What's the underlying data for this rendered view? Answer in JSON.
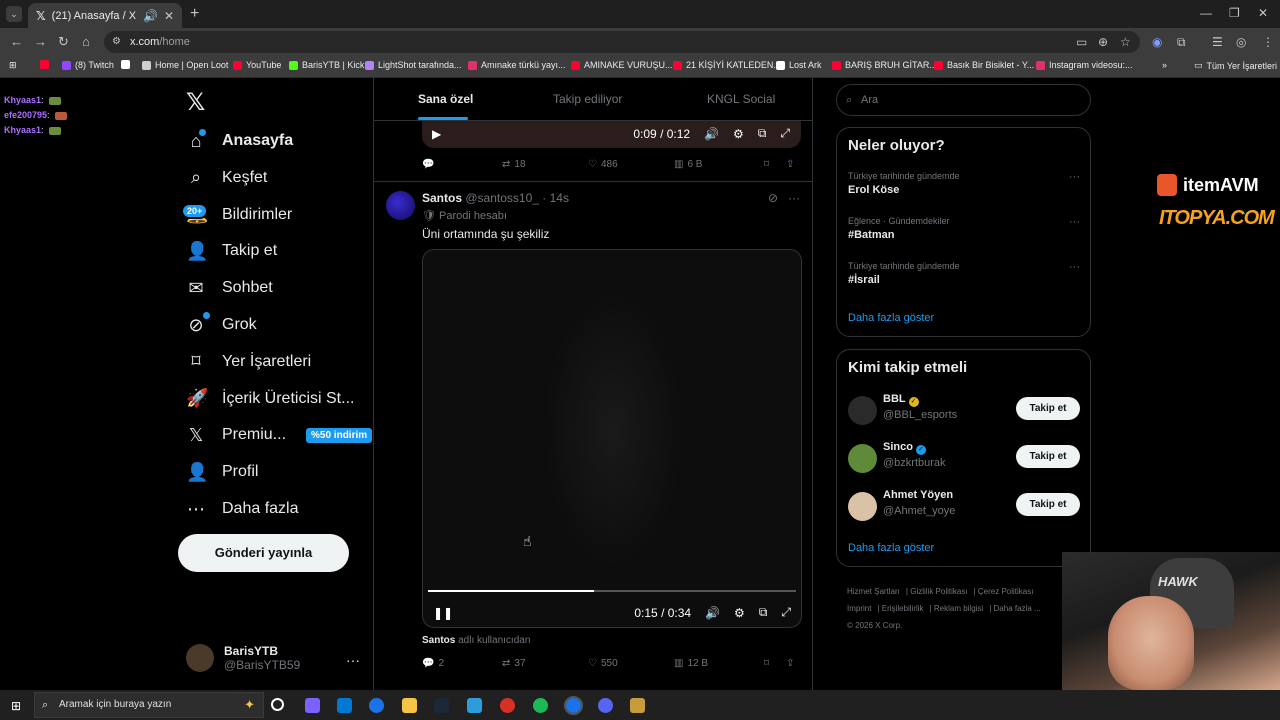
{
  "browser": {
    "tab_title": "(21) Anasayfa / X",
    "url_host": "x.com",
    "url_path": "/home",
    "all_bookmarks": "Tüm Yer İşaretleri",
    "bookmarks": [
      {
        "label": "",
        "color": "#ff0033"
      },
      {
        "label": "(8) Twitch",
        "color": "#9146ff"
      },
      {
        "label": "",
        "color": "#ffffff"
      },
      {
        "label": "Home | Open Loot",
        "color": "#d0d0d0"
      },
      {
        "label": "YouTube",
        "color": "#ff0033"
      },
      {
        "label": "BarisYTB | Kick",
        "color": "#53fc18"
      },
      {
        "label": "LightShot tarafında...",
        "color": "#b084f5"
      },
      {
        "label": "Amınake türkü yayı...",
        "color": "#e1306c"
      },
      {
        "label": "AMINAKE VURUŞU...",
        "color": "#ff0033"
      },
      {
        "label": "21 KİŞİYİ KATLEDEN...",
        "color": "#ff0033"
      },
      {
        "label": "Lost Ark",
        "color": "#ffffff"
      },
      {
        "label": "BARIŞ BRUH GİTAR...",
        "color": "#ff0033"
      },
      {
        "label": "Basık Bir Bisiklet - Y...",
        "color": "#ff0033"
      },
      {
        "label": "Instagram videosu:...",
        "color": "#e1306c"
      }
    ]
  },
  "chat": [
    {
      "user": "Khyaas1",
      "sep": ":"
    },
    {
      "user": "efe200795",
      "sep": ":"
    },
    {
      "user": "Khyaas1",
      "sep": ":"
    }
  ],
  "nav": {
    "items": [
      {
        "label": "Anasayfa",
        "icon": "home-icon"
      },
      {
        "label": "Keşfet",
        "icon": "search-icon"
      },
      {
        "label": "Bildirimler",
        "icon": "bell-icon"
      },
      {
        "label": "Takip et",
        "icon": "add-person-icon"
      },
      {
        "label": "Sohbet",
        "icon": "mail-icon"
      },
      {
        "label": "Grok",
        "icon": "grok-icon"
      },
      {
        "label": "Yer İşaretleri",
        "icon": "bookmark-icon"
      },
      {
        "label": "İçerik Üreticisi St...",
        "icon": "rocket-icon"
      },
      {
        "label": "Premiu...",
        "icon": "x-icon"
      },
      {
        "label": "Profil",
        "icon": "person-icon"
      },
      {
        "label": "Daha fazla",
        "icon": "more-circle-icon"
      }
    ],
    "notifications_badge": "20+",
    "premium_promo": "%50 indirim",
    "post_button": "Gönderi yayınla",
    "account_name": "BarisYTB",
    "account_handle": "@BarisYTB59"
  },
  "timeline": {
    "tabs": [
      "Sana özel",
      "Takip ediliyor",
      "KNGL Social"
    ],
    "tweet1": {
      "video_time": "0:09 / 0:12",
      "replies": "",
      "retweets": "18",
      "likes": "486",
      "views": "6 B"
    },
    "tweet2": {
      "name": "Santos",
      "handle": "@santoss10_",
      "time": "· 14s",
      "parody": "Parodi hesabı",
      "text": "Üni ortamında şu şekiliz",
      "video_time": "0:15 / 0:34",
      "progress": 0.45,
      "caption_name": "Santos",
      "caption_rest": "adlı kullanıcıdan",
      "replies": "2",
      "retweets": "37",
      "likes": "550",
      "views": "12 B"
    }
  },
  "right": {
    "search_placeholder": "Ara",
    "trends_title": "Neler oluyor?",
    "trends": [
      {
        "context": "Türkiye tarihinde gündemde",
        "topic": "Erol Köse"
      },
      {
        "context": "Eğlence · Gündemdekiler",
        "topic": "#Batman"
      },
      {
        "context": "Türkiye tarihinde gündemde",
        "topic": "#İsrail"
      }
    ],
    "show_more": "Daha fazla göster",
    "who_title": "Kimi takip etmeli",
    "who": [
      {
        "name": "BBL",
        "handle": "@BBL_esports",
        "verified_color": "#e2b719",
        "avatar_color": "#2a2a2a"
      },
      {
        "name": "Sinco",
        "handle": "@bzkrtburak",
        "verified_color": "#1d9bf0",
        "avatar_color": "#5e8a3a"
      },
      {
        "name": "Ahmet Yöyen",
        "handle": "@Ahmet_yoye",
        "verified_color": "",
        "avatar_color": "#d9c2a6"
      }
    ],
    "follow_label": "Takip et",
    "footer": [
      "Hizmet Şartları",
      "Gizlilik Politikası",
      "Çerez Politikası",
      "Imprint",
      "Erişilebilirlik",
      "Reklam bilgisi",
      "Daha fazla ...",
      "© 2026 X Corp."
    ]
  },
  "overlays": {
    "itemavm": "itemAVM",
    "itopya": "ITOPYA.COM",
    "hawk": "HAWK"
  },
  "taskbar": {
    "search_placeholder": "Aramak için buraya yazın"
  }
}
